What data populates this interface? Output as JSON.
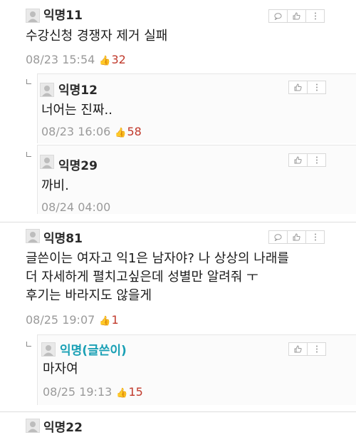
{
  "comments": [
    {
      "name": "익명11",
      "text": "수강신청 경쟁자 제거 실패",
      "time": "08/23 15:54",
      "votes": "32",
      "replies": [
        {
          "name": "익명12",
          "text": "너어는 진짜..",
          "time": "08/23 16:06",
          "votes": "58"
        },
        {
          "name": "익명29",
          "text": "까비.",
          "time": "08/24 04:00"
        }
      ]
    },
    {
      "name": "익명81",
      "text_lines": [
        "글쓴이는 여자고 익1은 남자야? 나 상상의 나래를",
        "더 자세하게 펼치고싶은데 성별만 알려줘 ㅜ",
        "후기는 바라지도 않을게"
      ],
      "time": "08/25 19:07",
      "votes": "1",
      "replies": [
        {
          "name": "익명(글쓴이)",
          "text": "마자여",
          "time": "08/25 19:13",
          "votes": "15"
        }
      ]
    },
    {
      "name": "익명22"
    }
  ],
  "icons": {
    "reply": "speech-bubble-icon",
    "like": "thumbs-up-icon",
    "more": "more-vertical-icon",
    "avatar": "default-avatar-icon"
  },
  "colors": {
    "votes": "#c0392b",
    "author_name": "#1aa0b5"
  }
}
